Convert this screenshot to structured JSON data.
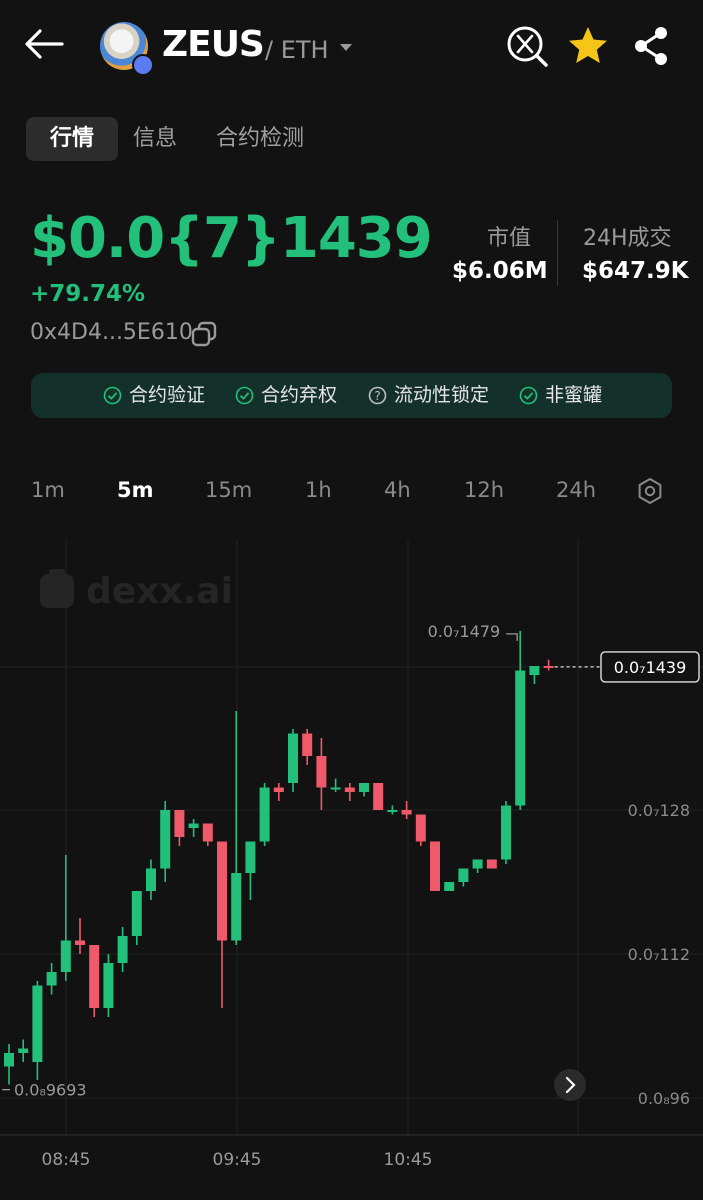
{
  "header": {
    "token_name": "ZEUS",
    "chain": "/ ETH",
    "icons": [
      "back-arrow-icon",
      "ethereum-icon",
      "x-search-icon",
      "star-icon",
      "share-icon"
    ],
    "star_color": "#f5c518"
  },
  "tabs": [
    {
      "label": "行情",
      "active": true
    },
    {
      "label": "信息",
      "active": false
    },
    {
      "label": "合约检测",
      "active": false
    }
  ],
  "price": {
    "value": "$0.0{7}1439",
    "change": "+79.74%",
    "address": "0x4D4...5E610",
    "color": "#22c07a"
  },
  "stats": {
    "market_cap_label": "市值",
    "market_cap_value": "$6.06M",
    "volume_label": "24H成交",
    "volume_value": "$647.9K"
  },
  "badges": [
    {
      "label": "合约验证",
      "icon": "check-circle-icon"
    },
    {
      "label": "合约弃权",
      "icon": "check-circle-icon"
    },
    {
      "label": "流动性锁定",
      "icon": "question-circle-icon"
    },
    {
      "label": "非蜜罐",
      "icon": "check-circle-icon"
    }
  ],
  "intervals": [
    {
      "label": "1m",
      "active": false
    },
    {
      "label": "5m",
      "active": true
    },
    {
      "label": "15m",
      "active": false
    },
    {
      "label": "1h",
      "active": false
    },
    {
      "label": "4h",
      "active": false
    },
    {
      "label": "12h",
      "active": false
    },
    {
      "label": "24h",
      "active": false
    }
  ],
  "chart_data": {
    "type": "candlestick",
    "watermark": "dexx.ai",
    "x_ticks": [
      "08:45",
      "09:45",
      "10:45"
    ],
    "y_ticks": [
      {
        "label": "0.0₇128",
        "value": 1.28
      },
      {
        "label": "0.0₇112",
        "value": 1.12
      },
      {
        "label": "0.0₈96",
        "value": 0.96
      }
    ],
    "current_price_label": "0.0₇1439",
    "current_price": 1.439,
    "high_marker_label": "0.0₇1479",
    "high_marker": 1.479,
    "low_marker_label": "0.0₈9693",
    "low_marker": 0.9693,
    "up_color": "#22c07a",
    "down_color": "#ef5a6a",
    "unit_note": "values in units of 1e-7 USD",
    "candles": [
      {
        "o": 0.995,
        "h": 1.02,
        "l": 0.975,
        "c": 1.01
      },
      {
        "o": 1.01,
        "h": 1.025,
        "l": 1.0,
        "c": 1.015
      },
      {
        "o": 1.0,
        "h": 1.09,
        "l": 0.98,
        "c": 1.085
      },
      {
        "o": 1.085,
        "h": 1.11,
        "l": 1.075,
        "c": 1.1
      },
      {
        "o": 1.1,
        "h": 1.23,
        "l": 1.09,
        "c": 1.135
      },
      {
        "o": 1.135,
        "h": 1.16,
        "l": 1.12,
        "c": 1.13
      },
      {
        "o": 1.13,
        "h": 1.13,
        "l": 1.05,
        "c": 1.06
      },
      {
        "o": 1.06,
        "h": 1.12,
        "l": 1.05,
        "c": 1.11
      },
      {
        "o": 1.11,
        "h": 1.15,
        "l": 1.1,
        "c": 1.14
      },
      {
        "o": 1.14,
        "h": 1.19,
        "l": 1.13,
        "c": 1.19
      },
      {
        "o": 1.19,
        "h": 1.225,
        "l": 1.18,
        "c": 1.215
      },
      {
        "o": 1.215,
        "h": 1.29,
        "l": 1.2,
        "c": 1.28
      },
      {
        "o": 1.28,
        "h": 1.28,
        "l": 1.24,
        "c": 1.25
      },
      {
        "o": 1.26,
        "h": 1.27,
        "l": 1.25,
        "c": 1.265
      },
      {
        "o": 1.265,
        "h": 1.265,
        "l": 1.24,
        "c": 1.245
      },
      {
        "o": 1.245,
        "h": 1.245,
        "l": 1.06,
        "c": 1.135
      },
      {
        "o": 1.135,
        "h": 1.39,
        "l": 1.13,
        "c": 1.21
      },
      {
        "o": 1.21,
        "h": 1.23,
        "l": 1.18,
        "c": 1.245
      },
      {
        "o": 1.245,
        "h": 1.31,
        "l": 1.24,
        "c": 1.305
      },
      {
        "o": 1.305,
        "h": 1.31,
        "l": 1.29,
        "c": 1.3
      },
      {
        "o": 1.31,
        "h": 1.37,
        "l": 1.3,
        "c": 1.365
      },
      {
        "o": 1.365,
        "h": 1.37,
        "l": 1.33,
        "c": 1.34
      },
      {
        "o": 1.34,
        "h": 1.36,
        "l": 1.28,
        "c": 1.305
      },
      {
        "o": 1.305,
        "h": 1.315,
        "l": 1.3,
        "c": 1.305
      },
      {
        "o": 1.305,
        "h": 1.31,
        "l": 1.29,
        "c": 1.3
      },
      {
        "o": 1.3,
        "h": 1.31,
        "l": 1.295,
        "c": 1.31
      },
      {
        "o": 1.31,
        "h": 1.31,
        "l": 1.28,
        "c": 1.28
      },
      {
        "o": 1.28,
        "h": 1.285,
        "l": 1.275,
        "c": 1.28
      },
      {
        "o": 1.28,
        "h": 1.29,
        "l": 1.27,
        "c": 1.275
      },
      {
        "o": 1.275,
        "h": 1.275,
        "l": 1.24,
        "c": 1.245
      },
      {
        "o": 1.245,
        "h": 1.245,
        "l": 1.19,
        "c": 1.19
      },
      {
        "o": 1.19,
        "h": 1.2,
        "l": 1.19,
        "c": 1.2
      },
      {
        "o": 1.2,
        "h": 1.215,
        "l": 1.195,
        "c": 1.215
      },
      {
        "o": 1.215,
        "h": 1.225,
        "l": 1.21,
        "c": 1.225
      },
      {
        "o": 1.225,
        "h": 1.225,
        "l": 1.215,
        "c": 1.215
      },
      {
        "o": 1.225,
        "h": 1.29,
        "l": 1.22,
        "c": 1.285
      },
      {
        "o": 1.285,
        "h": 1.479,
        "l": 1.28,
        "c": 1.435
      },
      {
        "o": 1.43,
        "h": 1.44,
        "l": 1.42,
        "c": 1.44
      },
      {
        "o": 1.44,
        "h": 1.447,
        "l": 1.435,
        "c": 1.439
      }
    ]
  }
}
